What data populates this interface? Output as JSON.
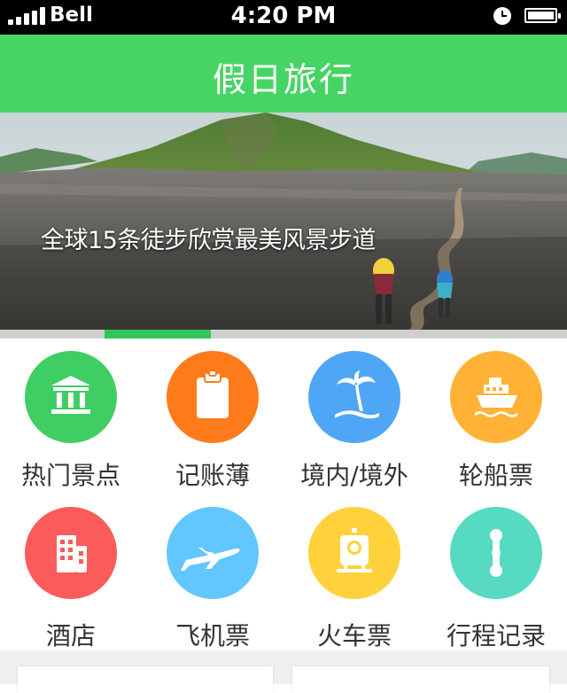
{
  "status_bar": {
    "carrier": "Bell",
    "time": "4:20 PM",
    "signal_icon": "signal-bars-icon",
    "alarm_icon": "clock-icon",
    "battery_icon": "battery-icon"
  },
  "header": {
    "title": "假日旅行"
  },
  "banner": {
    "caption": "全球15条徒步欣赏最美风景步道",
    "page_count": 5,
    "active_index": 1
  },
  "menu": {
    "items": [
      {
        "label": "热门景点",
        "icon": "landmark-icon",
        "color": "#3fce63"
      },
      {
        "label": "记账薄",
        "icon": "clipboard-icon",
        "color": "#ff7a1a"
      },
      {
        "label": "境内/境外",
        "icon": "palm-tree-icon",
        "color": "#4fa6f6"
      },
      {
        "label": "轮船票",
        "icon": "ship-icon",
        "color": "#ffb236"
      },
      {
        "label": "酒店",
        "icon": "hotel-icon",
        "color": "#fb5b5a"
      },
      {
        "label": "飞机票",
        "icon": "airplane-icon",
        "color": "#62c7ff"
      },
      {
        "label": "火车票",
        "icon": "train-icon",
        "color": "#ffd23c"
      },
      {
        "label": "行程记录",
        "icon": "route-icon",
        "color": "#56dbc2"
      }
    ]
  }
}
